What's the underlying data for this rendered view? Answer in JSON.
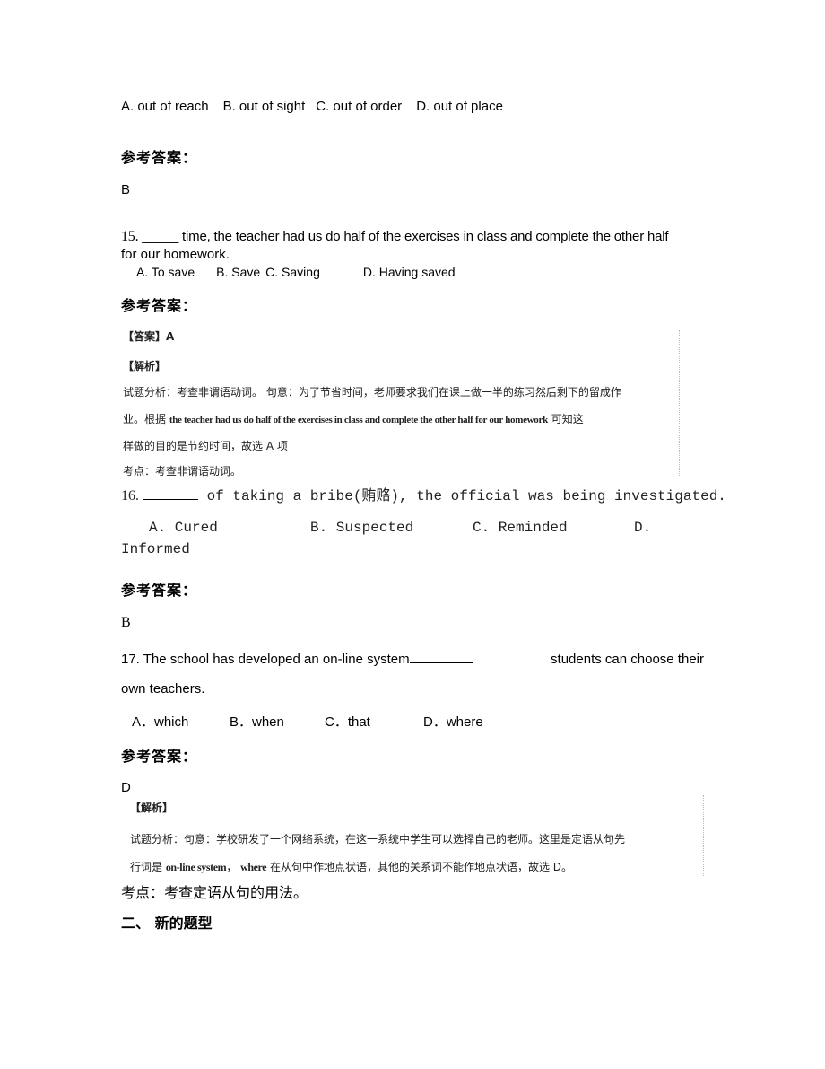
{
  "q14": {
    "options": [
      "A. out of reach",
      "B. out of sight",
      "C. out of order",
      "D. out of place"
    ],
    "answer_heading": "参考答案：",
    "answer": "B"
  },
  "q15": {
    "number": "15.",
    "blank": "_____",
    "stem_line1": " time, the teacher had us do half of the exercises in class and complete the other half",
    "stem_line2": "for our homework.",
    "options": [
      "A. To save",
      "B. Save",
      "C. Saving",
      "D. Having saved"
    ],
    "answer_heading": "参考答案：",
    "explanation": {
      "answer_label": "【答案】A",
      "analysis_label": "【解析】",
      "line1": "试题分析：考查非谓语动词。 句意：为了节省时间，老师要求我们在课上做一半的练习然后剩下的留成作",
      "line2_cn_start": "业。根据 ",
      "line2_en": "the teacher had us do half of the exercises in class and complete the other half for our homework",
      "line2_cn_end": " 可知这",
      "line3": "样做的目的是节约时间，故选 A 项",
      "point": "考点：考查非谓语动词。"
    }
  },
  "q16": {
    "number": "16.",
    "stem": " of taking a bribe(贿赂), the official was being investigated.",
    "options": [
      "A. Cured",
      "B. Suspected",
      "C. Reminded",
      "D."
    ],
    "option_d_wrap": "Informed",
    "answer_heading": "参考答案：",
    "answer": "B"
  },
  "q17": {
    "stem_part1": "17. The school has developed an on-line system",
    "stem_part2": " students can choose their",
    "stem_line2": "own teachers.",
    "options": [
      "A．which",
      "B．when",
      "C．that",
      "D．where"
    ],
    "answer_heading": "参考答案：",
    "answer": "D",
    "explanation": {
      "analysis_label": "【解析】",
      "line1": "试题分析：句意：学校研发了一个网络系统，在这一系统中学生可以选择自己的老师。这里是定语从句先",
      "line2_cn_start": "行词是 ",
      "line2_en1": "on-line system",
      "line2_mid": "， ",
      "line2_en2": "where",
      "line2_cn_end": " 在从句中作地点状语，其他的关系词不能作地点状语，故选 D。"
    },
    "point": "考点：考查定语从句的用法。"
  },
  "section": {
    "heading": "二、 新的题型"
  }
}
